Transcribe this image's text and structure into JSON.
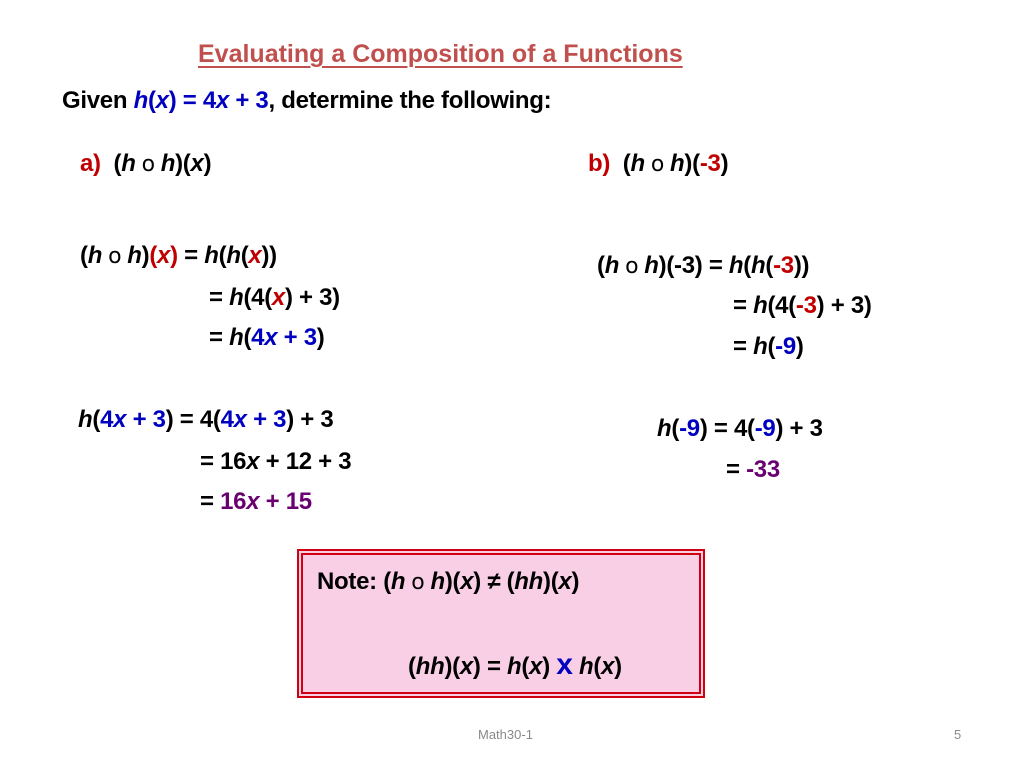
{
  "slide": {
    "title": "Evaluating a Composition of a Functions",
    "given": {
      "prefix": "Given ",
      "h": "h",
      "x": "x",
      "eq": " = 4",
      "x2": "x",
      "plus3": " + 3",
      "suffix": ", determine the following:"
    },
    "part_a": {
      "label": "a)",
      "question": {
        "h1": "h",
        "comp": "o",
        "h2": "h",
        "x": "x"
      },
      "line1": {
        "lhs_h1": "h",
        "lhs_h2": "h",
        "lhs_x": "x",
        "eq": " = ",
        "h": "h",
        "hin": "h",
        "x": "x"
      },
      "line2": {
        "eq": "= ",
        "h": "h",
        "four": "4(",
        "x": "x",
        "rest": ") + 3)"
      },
      "line3": {
        "eq": "= ",
        "h": "h",
        "inner_4": "4",
        "inner_x": "x",
        "inner_plus": " + 3"
      },
      "line4": {
        "h": "h",
        "arg_4": "4",
        "arg_x": "x",
        "arg_plus": " + 3",
        "eq": " = 4(",
        "rhs_4": "4",
        "rhs_x": "x",
        "rhs_plus": " + 3",
        "tail": ") + 3"
      },
      "line5": {
        "eq": "= 16",
        "x": "x",
        "rest": " + 12 + 3"
      },
      "line6": {
        "eq": "= ",
        "result_16": "16",
        "result_x": "x",
        "result_plus": " + 15"
      }
    },
    "part_b": {
      "label": "b)",
      "question": {
        "h1": "h",
        "comp": "o",
        "h2": "h",
        "arg": "-3"
      },
      "line1": {
        "lhs_h1": "h",
        "lhs_h2": "h",
        "lhs_arg": "(-3)",
        "eq": " = ",
        "h": "h",
        "hin": "h",
        "arg": "-3"
      },
      "line2": {
        "eq": "= ",
        "h": "h",
        "four": "4(",
        "arg": "-3",
        "rest": ") + 3)"
      },
      "line3": {
        "eq": "= ",
        "h": "h",
        "arg": "-9"
      },
      "line4": {
        "h": "h",
        "arg": "-9",
        "eq": " = 4(",
        "arg2": "-9",
        "tail": ") + 3"
      },
      "line5": {
        "eq": "= ",
        "result": "-33"
      }
    },
    "note": {
      "label": "Note: ",
      "line1": {
        "h1": "h",
        "comp": "o",
        "h2": "h",
        "x": "x",
        "neq": " ≠ ",
        "hh": "hh",
        "x2": "x"
      },
      "line2": {
        "hh": "hh",
        "x": "x",
        "eq": " = ",
        "h1": "h",
        "x1": "x",
        "times": "x",
        "h2": "h",
        "x2": "x"
      }
    },
    "footer": {
      "course": "Math30-1",
      "page": "5"
    }
  }
}
